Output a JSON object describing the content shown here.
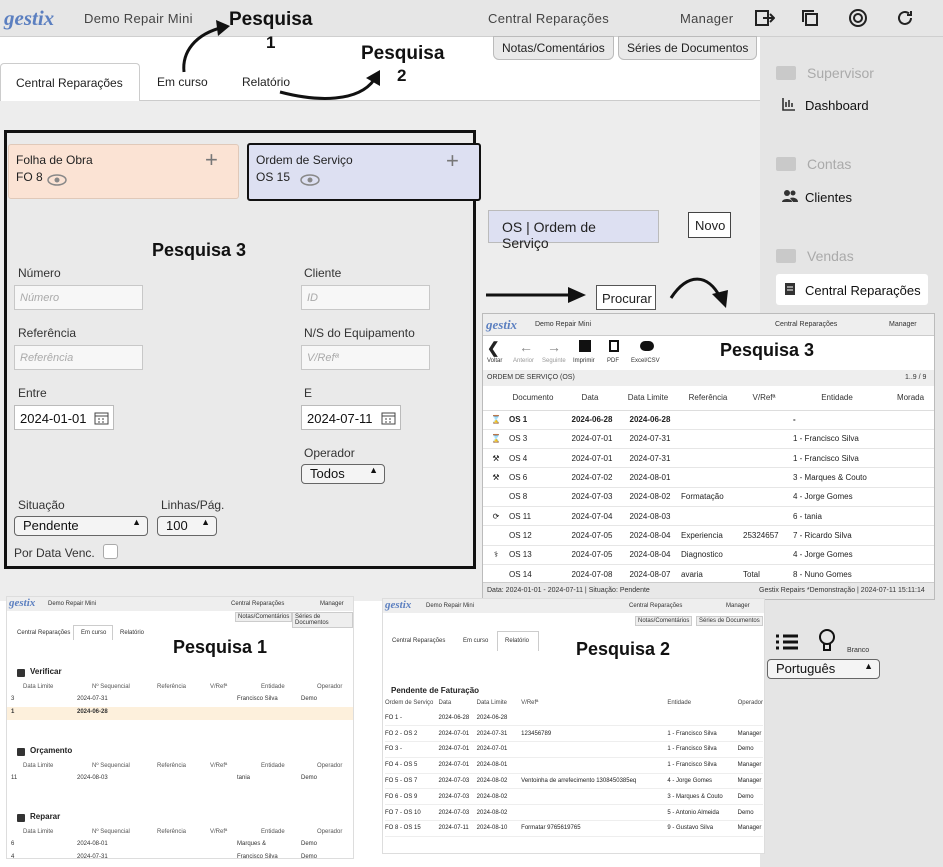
{
  "app": {
    "logo": "gestix",
    "company": "Demo Repair Mini",
    "module": "Central Reparações",
    "user": "Manager"
  },
  "annotations": {
    "p1": "Pesquisa",
    "p1n": "1",
    "p2": "Pesquisa",
    "p2n": "2",
    "p3": "Pesquisa 3",
    "p3b": "Pesquisa 3",
    "p1b": "Pesquisa 1",
    "p2b": "Pesquisa 2"
  },
  "topbuttons": {
    "notes": "Notas/Comentários",
    "series": "Séries de Documentos"
  },
  "tabs": [
    "Central Reparações",
    "Em curso",
    "Relatório"
  ],
  "sidebar": {
    "supervisor": "Supervisor",
    "dashboard": "Dashboard",
    "contas": "Contas",
    "clientes": "Clientes",
    "vendas": "Vendas",
    "central": "Central Reparações",
    "lang": "Português",
    "branco": "Branco"
  },
  "cards": {
    "fo_title": "Folha de Obra",
    "fo_val": "FO 8",
    "os_title": "Ordem de Serviço",
    "os_val": "OS 15",
    "plus": "+"
  },
  "form": {
    "numero": "Número",
    "numero_ph": "Número",
    "cliente": "Cliente",
    "cliente_ph": "ID",
    "referencia": "Referência",
    "referencia_ph": "Referência",
    "ns": "N/S do Equipamento",
    "ns_ph": "V/Refª",
    "entre": "Entre",
    "entre_val": "2024-01-01",
    "e": "E",
    "e_val": "2024-07-11",
    "operador": "Operador",
    "operador_val": "Todos",
    "situacao": "Situação",
    "situacao_val": "Pendente",
    "linhas": "Linhas/Pág.",
    "linhas_val": "100",
    "porvenc": "Por Data Venc."
  },
  "os_panel": {
    "label": "OS | Ordem de Serviço",
    "novo": "Novo",
    "procurar": "Procurar"
  },
  "os_list": {
    "toolbar": [
      "Voltar",
      "Anterior",
      "Seguinte",
      "Imprimir",
      "PDF",
      "Excel/CSV"
    ],
    "section": "ORDEM DE SERVIÇO (OS)",
    "pages": "1..9 / 9",
    "headers": [
      "Documento",
      "Data",
      "Data Limite",
      "Referência",
      "V/Refª",
      "Entidade",
      "Morada"
    ],
    "rows": [
      {
        "icon": "⌛",
        "d": "OS 1",
        "dt": "2024-06-28",
        "dl": "2024-06-28",
        "r": "",
        "v": "",
        "e": "-",
        "bold": true
      },
      {
        "icon": "⌛",
        "d": "OS 3",
        "dt": "2024-07-01",
        "dl": "2024-07-31",
        "r": "",
        "v": "",
        "e": "1 - Francisco Silva"
      },
      {
        "icon": "⚒",
        "d": "OS 4",
        "dt": "2024-07-01",
        "dl": "2024-07-31",
        "r": "",
        "v": "",
        "e": "1 - Francisco Silva"
      },
      {
        "icon": "⚒",
        "d": "OS 6",
        "dt": "2024-07-02",
        "dl": "2024-08-01",
        "r": "",
        "v": "",
        "e": "3 - Marques & Couto"
      },
      {
        "icon": "",
        "d": "OS 8",
        "dt": "2024-07-03",
        "dl": "2024-08-02",
        "r": "Formatação",
        "v": "",
        "e": "4 - Jorge Gomes"
      },
      {
        "icon": "⟳",
        "d": "OS 11",
        "dt": "2024-07-04",
        "dl": "2024-08-03",
        "r": "",
        "v": "",
        "e": "6 - tania"
      },
      {
        "icon": "",
        "d": "OS 12",
        "dt": "2024-07-05",
        "dl": "2024-08-04",
        "r": "Experiencia",
        "v": "25324657",
        "e": "7 - Ricardo Silva"
      },
      {
        "icon": "⚕",
        "d": "OS 13",
        "dt": "2024-07-05",
        "dl": "2024-08-04",
        "r": "Diagnostico",
        "v": "",
        "e": "4 - Jorge Gomes"
      },
      {
        "icon": "",
        "d": "OS 14",
        "dt": "2024-07-08",
        "dl": "2024-08-07",
        "r": "avaria",
        "v": "Total",
        "e": "8 - Nuno Gomes"
      }
    ],
    "footer_left": "Data: 2024-01-01 - 2024-07-11 | Situação: Pendente",
    "footer_right": "Gestix Repairs *Demonstração | 2024-07-11 15:11:14"
  },
  "p1": {
    "sections": [
      {
        "title": "Verificar",
        "headers": [
          "Data Limite",
          "Nº Sequencial",
          "Referência",
          "V/Refª",
          "Entidade",
          "Operador"
        ],
        "rows": [
          [
            "3",
            "2024-07-31",
            "",
            "",
            "Francisco Silva",
            "Demo"
          ],
          [
            "1",
            "2024-06-28",
            "",
            "",
            "",
            ""
          ]
        ]
      },
      {
        "title": "Orçamento",
        "headers": [
          "Data Limite",
          "Nº Sequencial",
          "Referência",
          "V/Refª",
          "Entidade",
          "Operador"
        ],
        "rows": [
          [
            "11",
            "2024-08-03",
            "",
            "",
            "tania",
            "Demo"
          ]
        ]
      },
      {
        "title": "Reparar",
        "headers": [
          "Data Limite",
          "Nº Sequencial",
          "Referência",
          "V/Refª",
          "Entidade",
          "Operador"
        ],
        "rows": [
          [
            "6",
            "2024-08-01",
            "",
            "",
            "Marques &",
            "Demo"
          ],
          [
            "4",
            "2024-07-31",
            "",
            "",
            "Francisco Silva",
            "Demo"
          ]
        ]
      }
    ]
  },
  "p2": {
    "title": "Pendente de Faturação",
    "headers": [
      "Ordem de Serviço",
      "Data",
      "Data Limite",
      "V/Refª",
      "Entidade",
      "Operador"
    ],
    "rows": [
      [
        "FO 1 -",
        "2024-06-28",
        "2024-06-28",
        "",
        "",
        ""
      ],
      [
        "FO 2 - OS 2",
        "2024-07-01",
        "2024-07-31",
        "123456789",
        "1 - Francisco Silva",
        "Manager"
      ],
      [
        "FO 3 -",
        "2024-07-01",
        "2024-07-01",
        "",
        "1 - Francisco Silva",
        "Demo"
      ],
      [
        "FO 4 - OS 5",
        "2024-07-01",
        "2024-08-01",
        "",
        "1 - Francisco Silva",
        "Manager"
      ],
      [
        "FO 5 - OS 7",
        "2024-07-03",
        "2024-08-02",
        "Ventoinha de arrefecimento 1308450385eq",
        "4 - Jorge Gomes",
        "Manager"
      ],
      [
        "FO 6 - OS 9",
        "2024-07-03",
        "2024-08-02",
        "",
        "3 - Marques & Couto",
        "Demo"
      ],
      [
        "FO 7 - OS 10",
        "2024-07-03",
        "2024-08-02",
        "",
        "5 - Antonio Almeida",
        "Demo"
      ],
      [
        "FO 8 - OS 15",
        "2024-07-11",
        "2024-08-10",
        "Formatar 9765619765",
        "9 - Gustavo Silva",
        "Manager"
      ]
    ]
  }
}
